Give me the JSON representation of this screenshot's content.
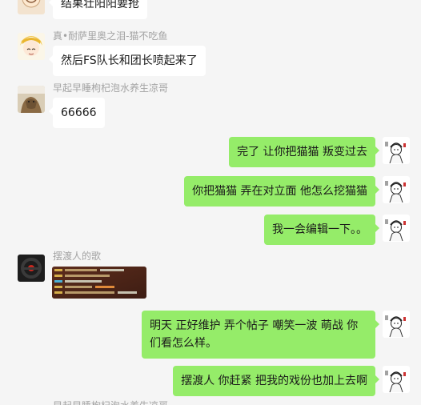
{
  "messages": [
    {
      "side": "left",
      "sender": "",
      "text": "结果壮阳阳要抢",
      "avatar": "cartoon-face-avatar"
    },
    {
      "side": "left",
      "sender": "真•耐萨里奥之泪-猫不吃鱼",
      "text": "然后FS队长和团长喷起来了",
      "avatar": "blond-anime-avatar"
    },
    {
      "side": "left",
      "sender": "早起早睡枸杞泡水养生凉哥",
      "text": "66666",
      "avatar": "dog-photo-avatar"
    },
    {
      "side": "right",
      "text": "完了 让你把猫猫 叛变过去",
      "avatar": "ink-sketch-avatar"
    },
    {
      "side": "right",
      "text": "你把猫猫 弄在对立面 他怎么挖猫猫",
      "avatar": "ink-sketch-avatar"
    },
    {
      "side": "right",
      "text": "我一会编辑一下。。",
      "avatar": "ink-sketch-avatar"
    },
    {
      "side": "left",
      "sender": "摆渡人的歌",
      "image": "game-chat-screenshot",
      "avatar": "steering-wheel-avatar"
    },
    {
      "side": "right",
      "text": "明天 正好维护 弄个帖子 嘲笑一波 萌战 你们看怎么样。",
      "avatar": "ink-sketch-avatar"
    },
    {
      "side": "right",
      "text": "摆渡人 你赶紧 把我的戏份也加上去啊",
      "avatar": "ink-sketch-avatar"
    },
    {
      "side": "left",
      "sender": "早起早睡枸杞泡水养生凉哥",
      "text": "",
      "avatar": "dog-photo-avatar"
    }
  ],
  "colors": {
    "background": "#f5f5f5",
    "self_bubble": "#95ec69",
    "other_bubble": "#ffffff",
    "sender_name": "#a3a3a3"
  }
}
